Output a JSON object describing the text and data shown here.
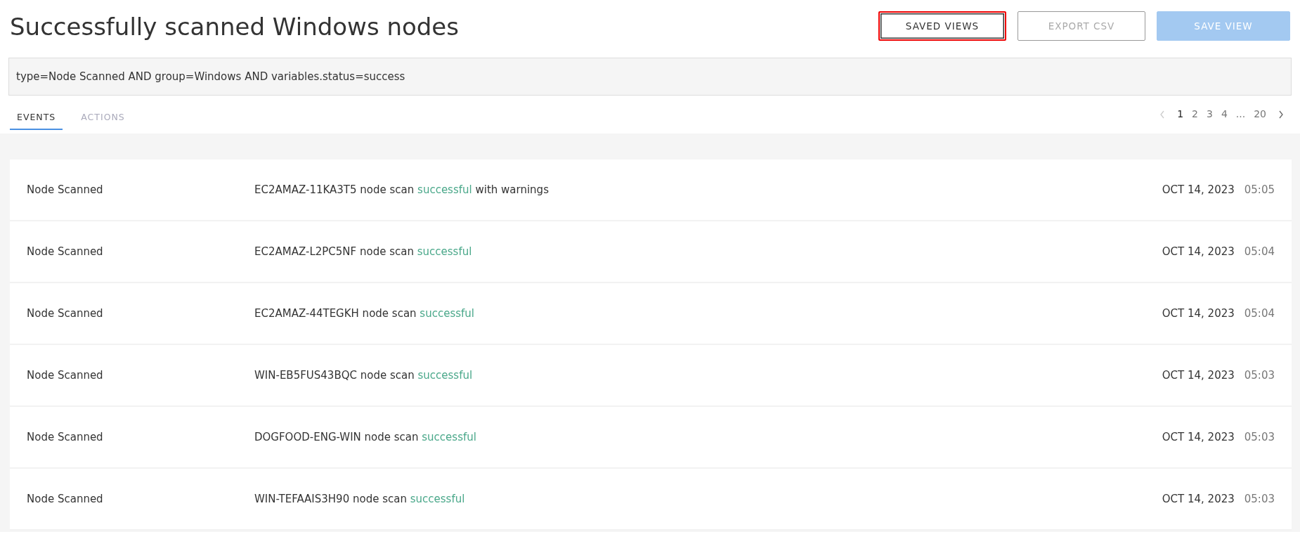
{
  "title": "Successfully scanned Windows nodes",
  "buttons": [
    {
      "label": "SAVED VIEWS",
      "kind": "outline",
      "disabled": false,
      "highlighted": true
    },
    {
      "label": "EXPORT CSV",
      "kind": "outline",
      "disabled": true,
      "highlighted": false
    },
    {
      "label": "SAVE VIEW",
      "kind": "primary",
      "disabled": true,
      "highlighted": false
    }
  ],
  "query": {
    "value": "type=Node Scanned AND group=Windows AND variables.status=success"
  },
  "tabs": [
    {
      "label": "EVENTS",
      "selected": true
    },
    {
      "label": "ACTIONS",
      "selected": false
    }
  ],
  "pagination": {
    "prev_disabled": true,
    "next_disabled": false,
    "pages": [
      {
        "label": "1",
        "selected": true
      },
      {
        "label": "2",
        "selected": false
      },
      {
        "label": "3",
        "selected": false
      },
      {
        "label": "4",
        "selected": false
      },
      {
        "label": "...",
        "selected": false
      },
      {
        "label": "20",
        "selected": false
      }
    ]
  },
  "events": [
    {
      "type": "Node Scanned",
      "host": "EC2AMAZ-11KA3T5 node scan",
      "status": "successful",
      "note": "with warnings",
      "date": "OCT 14, 2023",
      "time": "05:05"
    },
    {
      "type": "Node Scanned",
      "host": "EC2AMAZ-L2PC5NF node scan",
      "status": "successful",
      "date": "OCT 14, 2023",
      "time": "05:04"
    },
    {
      "type": "Node Scanned",
      "host": "EC2AMAZ-44TEGKH node scan",
      "status": "successful",
      "date": "OCT 14, 2023",
      "time": "05:04"
    },
    {
      "type": "Node Scanned",
      "host": "WIN-EB5FUS43BQC node scan",
      "status": "successful",
      "date": "OCT 14, 2023",
      "time": "05:03"
    },
    {
      "type": "Node Scanned",
      "host": "DOGFOOD-ENG-WIN node scan",
      "status": "successful",
      "date": "OCT 14, 2023",
      "time": "05:03"
    },
    {
      "type": "Node Scanned",
      "host": "WIN-TEFAAIS3H90 node scan",
      "status": "successful",
      "date": "OCT 14, 2023",
      "time": "05:03"
    }
  ]
}
